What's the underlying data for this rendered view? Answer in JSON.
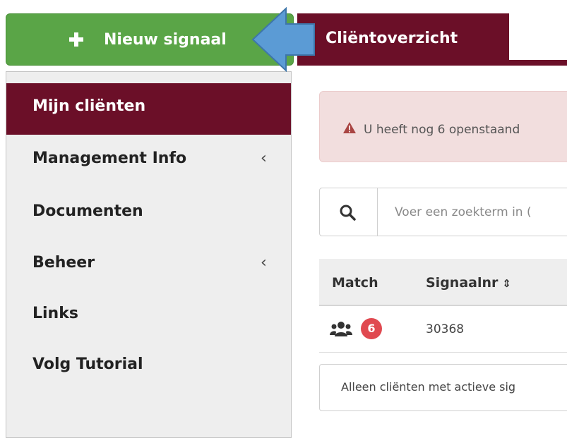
{
  "new_signal_button": {
    "label": "Nieuw signaal",
    "icon": "plus-icon"
  },
  "sidebar": {
    "items": [
      {
        "label": "Mijn cliënten",
        "active": true,
        "has_chevron": false
      },
      {
        "label": "Management Info",
        "active": false,
        "has_chevron": true,
        "chevron": "‹"
      },
      {
        "label": "Documenten",
        "active": false,
        "has_chevron": false
      },
      {
        "label": "Beheer",
        "active": false,
        "has_chevron": true,
        "chevron": "‹"
      },
      {
        "label": "Links",
        "active": false,
        "has_chevron": false
      },
      {
        "label": "Volg Tutorial",
        "active": false,
        "has_chevron": false
      }
    ]
  },
  "tabs": [
    {
      "label": "Cliëntoverzicht",
      "active": true
    }
  ],
  "alert": {
    "icon": "warning-icon",
    "text": "U heeft nog 6 openstaand"
  },
  "search": {
    "icon": "search-icon",
    "placeholder": "Voer een zoekterm in ("
  },
  "table": {
    "headers": {
      "match": "Match",
      "signaalnr": "Signaalnr",
      "sort_glyph": "⇕"
    },
    "rows": [
      {
        "match_icon": "users-icon",
        "match_count": "6",
        "signaalnr": "30368"
      }
    ]
  },
  "filter": {
    "label": "Alleen cliënten met actieve sig"
  },
  "colors": {
    "brand": "#6b0f28",
    "button_green": "#5aa547",
    "alert_bg": "#f2dede",
    "badge_red": "#e04950",
    "arrow_blue": "#5b9bd5"
  }
}
